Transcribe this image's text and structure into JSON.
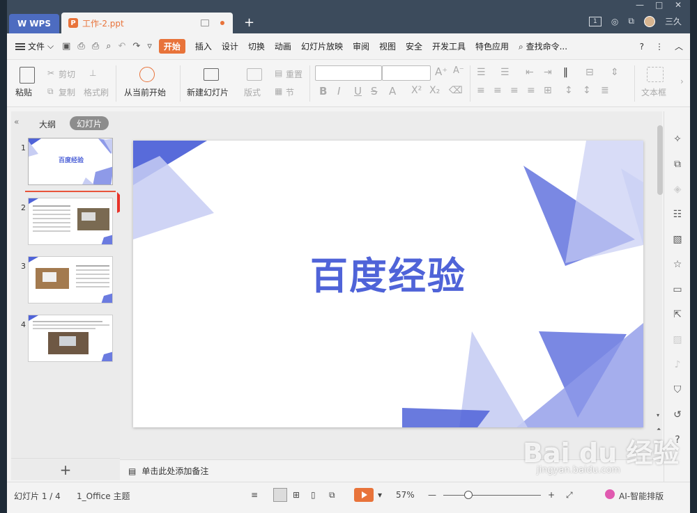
{
  "titlebar": {
    "app_tab": "WPS",
    "doc_tab": "工作-2.ppt",
    "new_tab": "+",
    "user": "三久",
    "badge": "1",
    "win_min": "—",
    "win_max": "□",
    "win_close": "✕"
  },
  "menu": {
    "file": "文件",
    "items": [
      "开始",
      "插入",
      "设计",
      "切换",
      "动画",
      "幻灯片放映",
      "审阅",
      "视图",
      "安全",
      "开发工具",
      "特色应用"
    ],
    "search": "查找命令..."
  },
  "ribbon": {
    "paste": "粘贴",
    "cut": "剪切",
    "copy": "复制",
    "format_painter": "格式刷",
    "from_current": "从当前开始",
    "new_slide": "新建幻灯片",
    "layout": "版式",
    "reset": "重置",
    "section": "节",
    "textbox": "文本框"
  },
  "left_panel": {
    "outline_tab": "大纲",
    "slides_tab": "幻灯片",
    "slide_numbers": [
      "1",
      "2",
      "3",
      "4"
    ],
    "thumb1_title": "百度经验"
  },
  "slide": {
    "title": "百度经验",
    "accent_dark": "#4f63d8",
    "accent_light": "#c7cdf3"
  },
  "notes": {
    "placeholder": "单击此处添加备注"
  },
  "statusbar": {
    "slide_counter": "幻灯片 1 / 4",
    "theme": "1_Office 主题",
    "zoom": "57%",
    "ai_layout": "AI-智能排版"
  },
  "watermark": {
    "brand": "Bai du 经验",
    "url": "jingyan.baidu.com"
  }
}
